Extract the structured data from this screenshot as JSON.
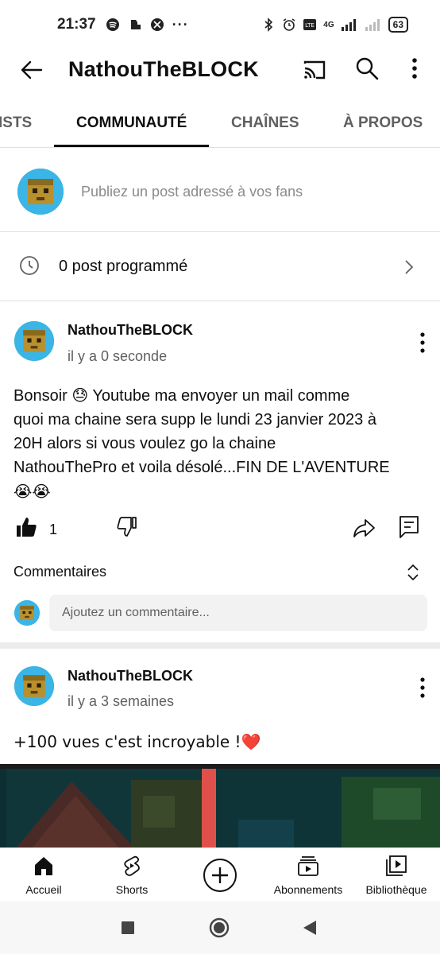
{
  "status_bar": {
    "time": "21:37",
    "network": "4G",
    "battery": "63"
  },
  "app_bar": {
    "title": "NathouTheBLOCK"
  },
  "tabs": [
    {
      "label": "ISTS",
      "active": false
    },
    {
      "label": "COMMUNAUTÉ",
      "active": true
    },
    {
      "label": "CHAÎNES",
      "active": false
    },
    {
      "label": "À PROPOS",
      "active": false
    }
  ],
  "composer": {
    "placeholder": "Publiez un post adressé à vos fans"
  },
  "scheduled": {
    "label": "0 post programmé"
  },
  "posts": [
    {
      "author": "NathouTheBLOCK",
      "time": "il y a 0 seconde",
      "text_line1": "Bonsoir 😓 Youtube ma envoyer un mail comme",
      "text_line2": "quoi ma chaine sera supp le lundi 23 janvier 2023 à",
      "text_line3": "20H alors si vous voulez go la chaine",
      "text_line4": "NathouThePro et voila désolé...FIN DE L'AVENTURE",
      "text_line5": "😭😭",
      "likes": "1",
      "comments_label": "Commentaires",
      "comment_placeholder": "Ajoutez un commentaire..."
    },
    {
      "author": "NathouTheBLOCK",
      "time": "il y a 3 semaines",
      "text": "+100 vues c'est incroyable !❤️"
    }
  ],
  "bottom_nav": [
    {
      "label": "Accueil",
      "icon": "home-icon"
    },
    {
      "label": "Shorts",
      "icon": "shorts-icon"
    },
    {
      "label": "",
      "icon": "create-icon"
    },
    {
      "label": "Abonnements",
      "icon": "subscriptions-icon"
    },
    {
      "label": "Bibliothèque",
      "icon": "library-icon"
    }
  ],
  "colors": {
    "avatar_bg": "#3ab5e6",
    "heart": "#e02d2d",
    "image_accent": "#e0504a"
  }
}
